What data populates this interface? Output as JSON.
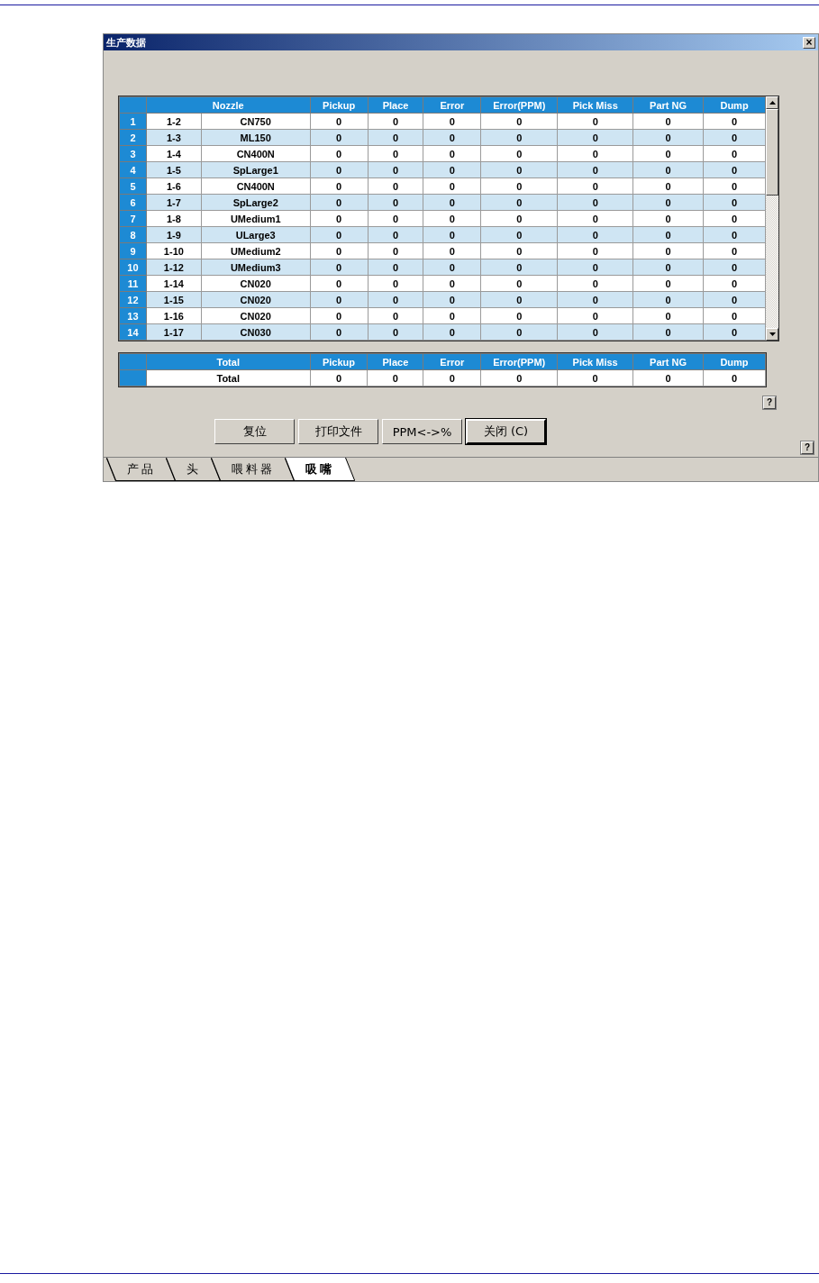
{
  "window": {
    "title": "生产数据",
    "close": "×"
  },
  "table": {
    "columns": [
      "Nozzle",
      "Pickup",
      "Place",
      "Error",
      "Error(PPM)",
      "Pick Miss",
      "Part NG",
      "Dump"
    ],
    "rows": [
      {
        "index": "1",
        "id": "1-2",
        "name": "CN750",
        "values": [
          "0",
          "0",
          "0",
          "0",
          "0",
          "0",
          "0"
        ]
      },
      {
        "index": "2",
        "id": "1-3",
        "name": "ML150",
        "values": [
          "0",
          "0",
          "0",
          "0",
          "0",
          "0",
          "0"
        ]
      },
      {
        "index": "3",
        "id": "1-4",
        "name": "CN400N",
        "values": [
          "0",
          "0",
          "0",
          "0",
          "0",
          "0",
          "0"
        ]
      },
      {
        "index": "4",
        "id": "1-5",
        "name": "SpLarge1",
        "values": [
          "0",
          "0",
          "0",
          "0",
          "0",
          "0",
          "0"
        ]
      },
      {
        "index": "5",
        "id": "1-6",
        "name": "CN400N",
        "values": [
          "0",
          "0",
          "0",
          "0",
          "0",
          "0",
          "0"
        ]
      },
      {
        "index": "6",
        "id": "1-7",
        "name": "SpLarge2",
        "values": [
          "0",
          "0",
          "0",
          "0",
          "0",
          "0",
          "0"
        ]
      },
      {
        "index": "7",
        "id": "1-8",
        "name": "UMedium1",
        "values": [
          "0",
          "0",
          "0",
          "0",
          "0",
          "0",
          "0"
        ]
      },
      {
        "index": "8",
        "id": "1-9",
        "name": "ULarge3",
        "values": [
          "0",
          "0",
          "0",
          "0",
          "0",
          "0",
          "0"
        ]
      },
      {
        "index": "9",
        "id": "1-10",
        "name": "UMedium2",
        "values": [
          "0",
          "0",
          "0",
          "0",
          "0",
          "0",
          "0"
        ]
      },
      {
        "index": "10",
        "id": "1-12",
        "name": "UMedium3",
        "values": [
          "0",
          "0",
          "0",
          "0",
          "0",
          "0",
          "0"
        ]
      },
      {
        "index": "11",
        "id": "1-14",
        "name": "CN020",
        "values": [
          "0",
          "0",
          "0",
          "0",
          "0",
          "0",
          "0"
        ]
      },
      {
        "index": "12",
        "id": "1-15",
        "name": "CN020",
        "values": [
          "0",
          "0",
          "0",
          "0",
          "0",
          "0",
          "0"
        ]
      },
      {
        "index": "13",
        "id": "1-16",
        "name": "CN020",
        "values": [
          "0",
          "0",
          "0",
          "0",
          "0",
          "0",
          "0"
        ]
      },
      {
        "index": "14",
        "id": "1-17",
        "name": "CN030",
        "values": [
          "0",
          "0",
          "0",
          "0",
          "0",
          "0",
          "0"
        ]
      }
    ]
  },
  "totals": {
    "columns": [
      "Total",
      "Pickup",
      "Place",
      "Error",
      "Error(PPM)",
      "Pick Miss",
      "Part NG",
      "Dump"
    ],
    "row": {
      "label": "Total",
      "values": [
        "0",
        "0",
        "0",
        "0",
        "0",
        "0",
        "0"
      ]
    }
  },
  "help_buttons": [
    "?",
    "?"
  ],
  "buttons": [
    {
      "label": "复位",
      "default": false
    },
    {
      "label": "打印文件",
      "default": false
    },
    {
      "label": "PPM<->%",
      "default": false
    },
    {
      "label": "关闭 (C)",
      "default": true
    }
  ],
  "tabs": [
    {
      "label": "产品",
      "selected": false
    },
    {
      "label": "头",
      "selected": false
    },
    {
      "label": "喂料器",
      "selected": false
    },
    {
      "label": "吸嘴",
      "selected": true
    }
  ]
}
